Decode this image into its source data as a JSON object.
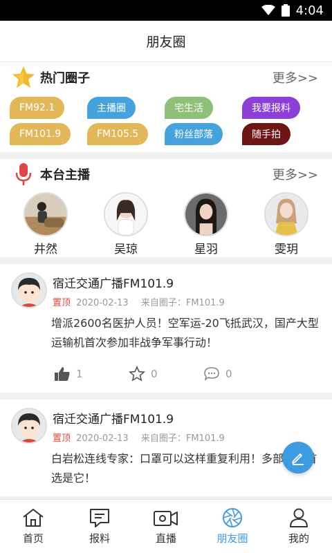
{
  "status": {
    "time": "4:04"
  },
  "header": {
    "title": "朋友圈"
  },
  "hot_circles": {
    "title": "热门圈子",
    "more": "更多>>",
    "tags": [
      {
        "label": "FM92.1",
        "color": "#e2b75a"
      },
      {
        "label": "主播圈",
        "color": "#45a2dc"
      },
      {
        "label": "宅生活",
        "color": "#8fbf78"
      },
      {
        "label": "我要报料",
        "color": "#8b3fd6"
      },
      {
        "label": "FM101.9",
        "color": "#e2b75a"
      },
      {
        "label": "FM105.5",
        "color": "#e2b75a"
      },
      {
        "label": "粉丝部落",
        "color": "#45a2dc"
      },
      {
        "label": "随手拍",
        "color": "#6e1515"
      }
    ]
  },
  "hosts": {
    "title": "本台主播",
    "more": "更多>>",
    "items": [
      {
        "name": "井然"
      },
      {
        "name": "吴琼"
      },
      {
        "name": "星羽"
      },
      {
        "name": "雯玥"
      }
    ]
  },
  "posts": [
    {
      "author": "宿迁交通广播FM101.9",
      "pin": "置顶",
      "date": "2020-02-13",
      "source": "来自圈子：FM101.9",
      "text": "增派2600名医护人员！空军运-20飞抵武汉，国产大型运输机首次参加非战争军事行动！",
      "likes": "1",
      "favorites": "0",
      "comments": "0"
    },
    {
      "author": "宿迁交通广播FM101.9",
      "pin": "置顶",
      "date": "2020-02-13",
      "source": "来自圈子：FM101.9",
      "text": "白岩松连线专家：口罩可以这样重复利用！多部消毒首选是它！",
      "likes": "",
      "favorites": "",
      "comments": ""
    }
  ],
  "tabbar": {
    "items": [
      {
        "label": "首页",
        "icon": "home-icon"
      },
      {
        "label": "报料",
        "icon": "report-icon"
      },
      {
        "label": "直播",
        "icon": "camera-icon"
      },
      {
        "label": "朋友圈",
        "icon": "aperture-icon"
      },
      {
        "label": "我的",
        "icon": "user-icon"
      }
    ],
    "active_index": 3,
    "accent": "#3f9be0"
  }
}
